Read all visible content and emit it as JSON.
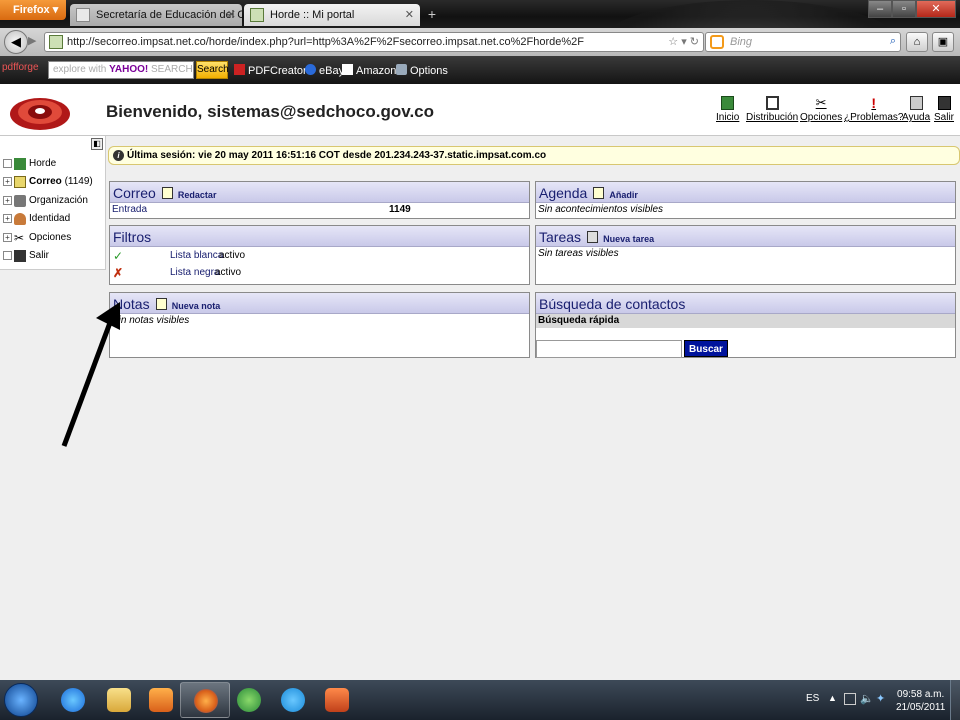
{
  "browser": {
    "app_button": "Firefox",
    "tabs": [
      {
        "title": "Secretaría de Educación del Chocó",
        "active": false
      },
      {
        "title": "Horde :: Mi portal",
        "active": true
      }
    ],
    "url": "http://secorreo.impsat.net.co/horde/index.php?url=http%3A%2F%2Fsecorreo.impsat.net.co%2Fhorde%2F",
    "search_placeholder": "Bing",
    "toolbar": {
      "pdfforge": "pdfforge",
      "yahoo_field_prefix": "explore with",
      "yahoo_field_brand": "YAHOO!",
      "yahoo_field_suffix": "SEARCH",
      "search_button": "Search",
      "items": [
        "PDFCreator",
        "eBay",
        "Amazon",
        "Options"
      ]
    }
  },
  "header": {
    "welcome": "Bienvenido, sistemas@sedchoco.gov.co",
    "nav": [
      "Inicio",
      "Distribución",
      "Opciones",
      "¿Problemas?",
      "Ayuda",
      "Salir"
    ]
  },
  "sidebar": {
    "items": [
      {
        "label": "Horde",
        "bold": false,
        "count": ""
      },
      {
        "label": "Correo",
        "bold": true,
        "count": "(1149)"
      },
      {
        "label": "Organización",
        "bold": false,
        "count": ""
      },
      {
        "label": "Identidad",
        "bold": false,
        "count": ""
      },
      {
        "label": "Opciones",
        "bold": false,
        "count": ""
      },
      {
        "label": "Salir",
        "bold": false,
        "count": ""
      }
    ]
  },
  "last_login": "Última sesión: vie 20 may 2011 16:51:16 COT desde 201.234.243-37.static.impsat.com.co",
  "blocks": {
    "correo": {
      "title": "Correo",
      "link": "Redactar",
      "folder": "Entrada",
      "count": "1149"
    },
    "agenda": {
      "title": "Agenda",
      "link": "Añadir",
      "empty": "Sin acontecimientos visibles"
    },
    "filtros": {
      "title": "Filtros",
      "rows": [
        {
          "name": "Lista blanca",
          "status": "activo",
          "icon": "check-icon"
        },
        {
          "name": "Lista negra",
          "status": "activo",
          "icon": "x-icon"
        }
      ]
    },
    "tareas": {
      "title": "Tareas",
      "link": "Nueva tarea",
      "empty": "Sin tareas visibles"
    },
    "notas": {
      "title": "Notas",
      "link": "Nueva nota",
      "empty": "Sin notas visibles"
    },
    "contactos": {
      "title": "Búsqueda de contactos",
      "subheader": "Búsqueda rápida",
      "button": "Buscar"
    }
  },
  "taskbar": {
    "language": "ES",
    "time": "09:58 a.m.",
    "date": "21/05/2011"
  },
  "colors": {
    "block_title": "#1a2070",
    "block_header_bg": "#d4d4ee",
    "search_button": "#00139c",
    "last_login_bg": "#ffffe0"
  }
}
